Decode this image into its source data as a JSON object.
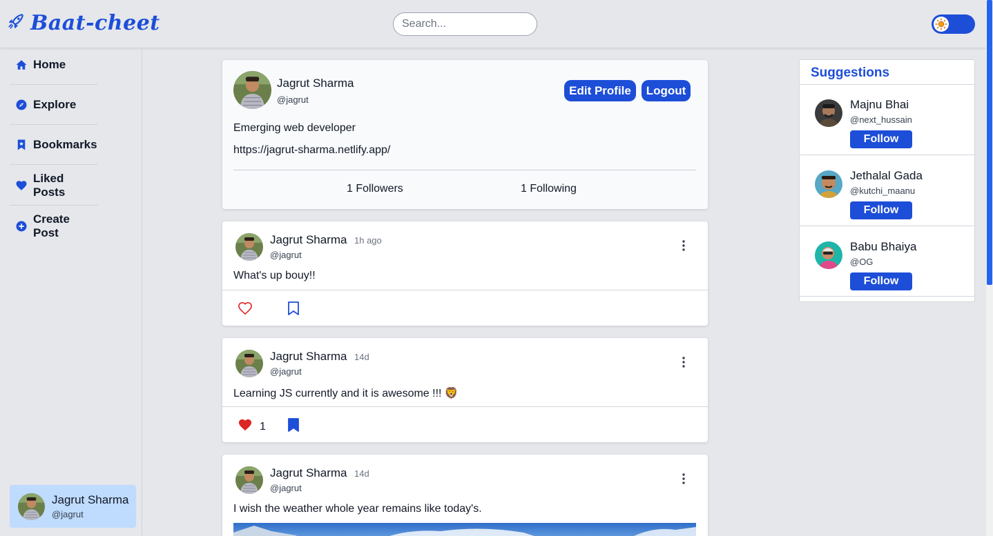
{
  "app": {
    "name": "Baat-cheet"
  },
  "search": {
    "placeholder": "Search..."
  },
  "colors": {
    "accent": "#1d4ed8",
    "like_red": "#dc2626",
    "user_card_bg": "#bfdbfe"
  },
  "nav": {
    "items": [
      {
        "label": "Home",
        "icon": "home-icon"
      },
      {
        "label": "Explore",
        "icon": "compass-icon"
      },
      {
        "label": "Bookmarks",
        "icon": "bookmark-icon"
      },
      {
        "label": "Liked Posts",
        "icon": "heart-icon"
      },
      {
        "label": "Create Post",
        "icon": "plus-circle-icon"
      }
    ]
  },
  "current_user": {
    "name": "Jagrut Sharma",
    "handle": "@jagrut"
  },
  "profile": {
    "name": "Jagrut Sharma",
    "handle": "@jagrut",
    "edit_label": "Edit Profile",
    "logout_label": "Logout",
    "bio": "Emerging web developer",
    "link": "https://jagrut-sharma.netlify.app/",
    "followers": "1 Followers",
    "following": "1 Following"
  },
  "posts": [
    {
      "name": "Jagrut Sharma",
      "handle": "@jagrut",
      "time": "1h ago",
      "text": "What's up bouy!!",
      "liked": false,
      "likes": "",
      "bookmarked": false
    },
    {
      "name": "Jagrut Sharma",
      "handle": "@jagrut",
      "time": "14d",
      "text": "Learning JS currently and it is awesome !!! 🦁",
      "liked": true,
      "likes": "1",
      "bookmarked": true
    },
    {
      "name": "Jagrut Sharma",
      "handle": "@jagrut",
      "time": "14d",
      "text": "I wish the weather whole year remains like today's."
    }
  ],
  "suggestions": {
    "title": "Suggestions",
    "follow_label": "Follow",
    "items": [
      {
        "name": "Majnu Bhai",
        "handle": "@next_hussain"
      },
      {
        "name": "Jethalal Gada",
        "handle": "@kutchi_maanu"
      },
      {
        "name": "Babu Bhaiya",
        "handle": "@OG"
      }
    ]
  }
}
